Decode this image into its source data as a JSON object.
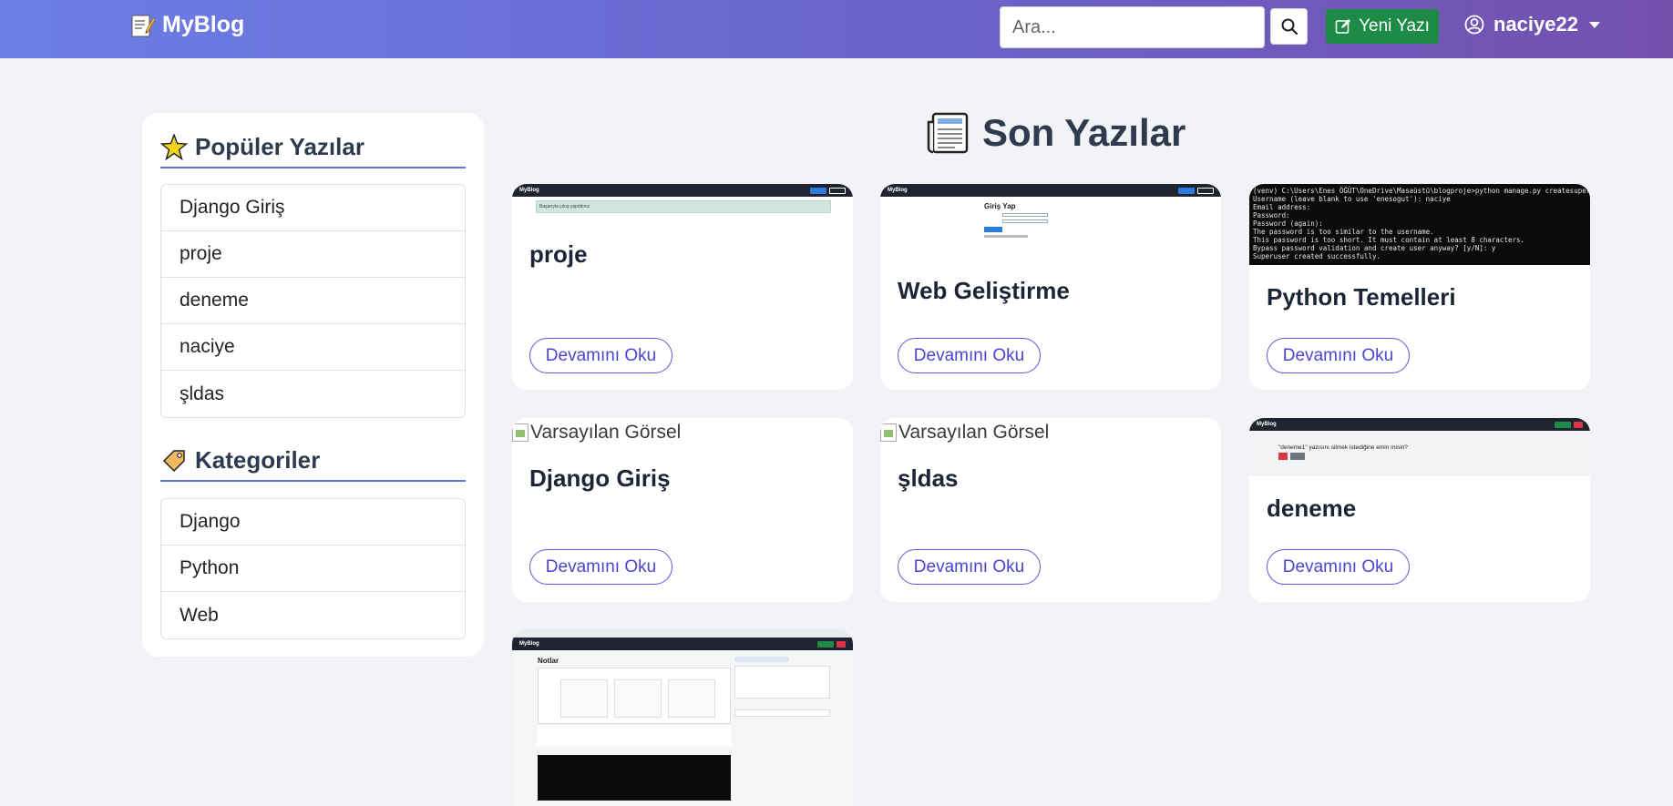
{
  "navbar": {
    "brand": "MyBlog",
    "brand_icon": "memo-icon",
    "search_placeholder": "Ara...",
    "new_post_label": "Yeni Yazı",
    "username": "naciye22",
    "colors": {
      "gradient_start": "#6b7fe6",
      "gradient_end": "#7450ad",
      "new_post": "#1e8a47"
    }
  },
  "sidebar": {
    "popular_heading": "Popüler Yazılar",
    "popular_icon": "glowing-star-icon",
    "popular": [
      "Django Giriş",
      "proje",
      "deneme",
      "naciye",
      "şldas"
    ],
    "categories_heading": "Kategoriler",
    "categories_icon": "label-tag-icon",
    "categories": [
      "Django",
      "Python",
      "Web"
    ]
  },
  "main": {
    "title": "Son Yazılar",
    "title_icon": "newspaper-icon",
    "read_more_label": "Devamını Oku",
    "default_image_alt": "Varsayılan Görsel",
    "posts": [
      {
        "title": "proje",
        "thumb": "screenshot"
      },
      {
        "title": "Web Geliştirme",
        "thumb": "screenshot"
      },
      {
        "title": "Python Temelleri",
        "thumb": "terminal"
      },
      {
        "title": "Django Giriş",
        "thumb": "broken"
      },
      {
        "title": "şldas",
        "thumb": "broken"
      },
      {
        "title": "deneme",
        "thumb": "screenshot"
      },
      {
        "title": "",
        "thumb": "screenshot"
      }
    ],
    "thumbs": {
      "proje_alert": "Başarıyla çıkış yapıldınız",
      "login_title": "Giriş Yap",
      "terminal_lines": [
        "(venv) C:\\Users\\Enes ÖĞÜT\\OneDrive\\Masaüstü\\blogproje>python manage.py createsuperuser",
        "Username (leave blank to use 'enesogut'): naciye",
        "Email address:",
        "Password:",
        "Password (again):",
        "The password is too similar to the username.",
        "This password is too short. It must contain at least 8 characters.",
        "Bypass password validation and create user anyway? [y/N]: y",
        "Superuser created successfully."
      ],
      "delete_question": "\"deneme1\" yazısını silmek istediğine emin misin?",
      "notes_title": "Notlar"
    }
  }
}
